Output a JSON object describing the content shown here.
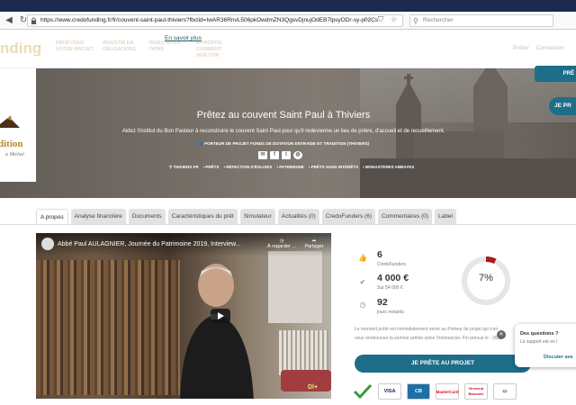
{
  "browser": {
    "url": "https://www.credofunding.fr/fr/couvent-saint-paul-thiviers?fbclid=IwAR36RnvL506pkOwdmZN3QgsvDjnujOdEB7lpsyODr-sy-p02Cs",
    "search_placeholder": "Rechercher"
  },
  "header": {
    "logo": "nding",
    "nav": [
      "PROPOSER VOTRE PROJET",
      "INVESTIR EN OBLIGATIONS",
      "INVESTIR EN DONS",
      "A PROPOS COMMENT INVESTIR"
    ],
    "en_savoir_plus": "En savoir plus",
    "right_nav": [
      "Prêter",
      "Connexion"
    ],
    "top_button": "PRÊ",
    "oval_button": "JE PR"
  },
  "logo_card": {
    "word": "dition",
    "sub": "e Michel"
  },
  "hero": {
    "title": "Prêtez au couvent Saint Paul à Thiviers",
    "description": "Aidez l'institut du Bon Pasteur à reconstruire le couvent Saint Paul pour qu'il redevienne un lieu de prière, d'accueil et de recueillement.",
    "porteur": "PORTEUR DE PROJET FONDS DE DOTATION ENTRAIDE ET TRADITION (THIVIERS)",
    "tags": [
      "THIVIERS FR",
      "PRÊTS",
      "RÉFECTION D'ÉGLISES",
      "PATRIMOINE",
      "PRÊTS SANS INTÉRÊTS",
      "MONASTÈRES ABBAYES"
    ]
  },
  "tabs": [
    "A propos",
    "Analyse financière",
    "Documents",
    "Caractéristiques du prêt",
    "Simulateur",
    "Actualités (0)",
    "CredoFunders (6)",
    "Commentaires (0)",
    "Label"
  ],
  "video": {
    "title": "Abbé Paul AULAGNIER, Journée du Patrimoine 2019, Interview...",
    "watch_later": "À regarder ...",
    "share": "Partager",
    "logo": "Dl+"
  },
  "stats": {
    "funders_value": "6",
    "funders_label": "CredoFunders",
    "amount_value": "4 000 €",
    "amount_label": "Sur 54 000 €",
    "days_value": "92",
    "days_label": "jours restants",
    "progress_text": "7%",
    "progress": 0.07
  },
  "info_text": {
    "line1": "Le montant prêté est immédiatement versé au Porteur de projet qui s'en",
    "line2": "vous rembourser la somme prêtée selon l'échéancier. Fin prévue le : 26/1"
  },
  "invest_button": "JE PRÊTE AU PROJET",
  "chat": {
    "title": "Des questions ?",
    "text": "Le support est en l",
    "link": "Discuter ave"
  },
  "payments": [
    "VISA",
    "CB",
    "MasterCard",
    "Virement Bancaire"
  ],
  "colors": {
    "primary": "#1e6e8a",
    "gauge": "#a61c1c"
  }
}
